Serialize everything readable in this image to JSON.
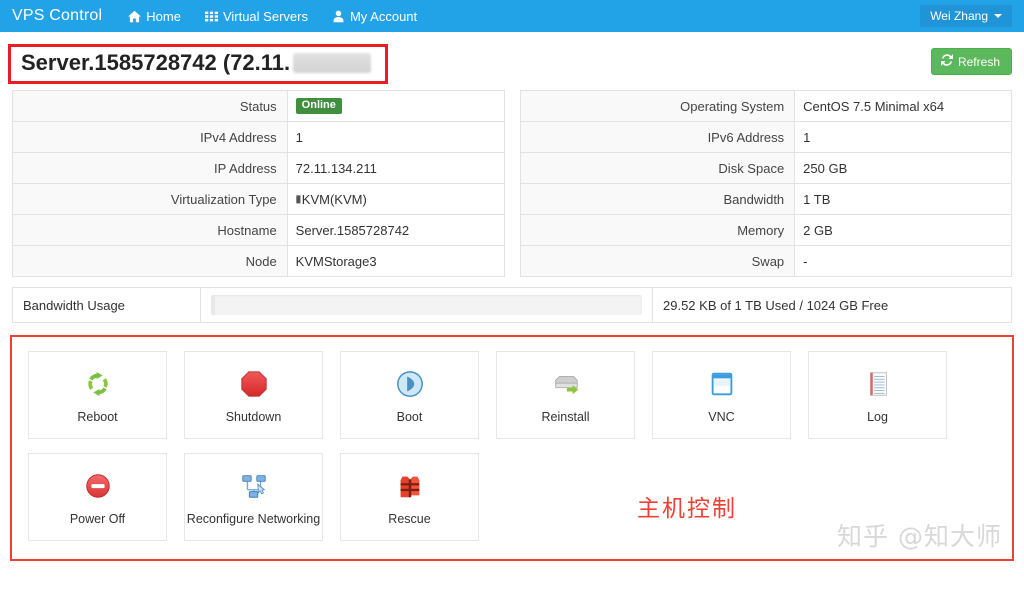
{
  "navbar": {
    "brand": "VPS Control",
    "items": [
      {
        "label": "Home",
        "icon": "home-icon"
      },
      {
        "label": "Virtual Servers",
        "icon": "grid-icon"
      },
      {
        "label": "My Account",
        "icon": "user-icon"
      }
    ],
    "user": "Wei Zhang",
    "accent_color": "#22a3e8"
  },
  "page": {
    "title_prefix": "Server.1585728742 (72.11.",
    "title_suffix": "",
    "title_redacted": true,
    "refresh_label": "Refresh",
    "refresh_icon": "refresh-icon",
    "annotation_border_color": "#ec1c24"
  },
  "left_table": {
    "rows": [
      {
        "label": "Status",
        "value": "Online",
        "type": "badge",
        "badge_color": "#3f8f3f"
      },
      {
        "label": "IPv4 Address",
        "value": "1",
        "type": "text"
      },
      {
        "label": "IP Address",
        "value": "72.11.134.211",
        "type": "text"
      },
      {
        "label": "Virtualization Type",
        "value": "KVM(KVM)",
        "type": "kvm"
      },
      {
        "label": "Hostname",
        "value": "Server.1585728742",
        "type": "text"
      },
      {
        "label": "Node",
        "value": "KVMStorage3",
        "type": "text"
      }
    ]
  },
  "right_table": {
    "rows": [
      {
        "label": "Operating System",
        "value": "CentOS 7.5 Minimal x64",
        "type": "text"
      },
      {
        "label": "IPv6 Address",
        "value": "1",
        "type": "text"
      },
      {
        "label": "Disk Space",
        "value": "250 GB",
        "type": "text"
      },
      {
        "label": "Bandwidth",
        "value": "1 TB",
        "type": "text"
      },
      {
        "label": "Memory",
        "value": "2 GB",
        "type": "text"
      },
      {
        "label": "Swap",
        "value": "-",
        "type": "text"
      }
    ]
  },
  "bandwidth": {
    "label": "Bandwidth Usage",
    "usage_text": "29.52 KB of 1 TB Used / 1024 GB Free",
    "percent": 1
  },
  "actions": {
    "border_color": "#ef4036",
    "annotation": "主机控制",
    "watermark": "知乎 @知大师",
    "items": [
      {
        "label": "Reboot",
        "icon": "reboot-icon"
      },
      {
        "label": "Shutdown",
        "icon": "stop-octagon-icon"
      },
      {
        "label": "Boot",
        "icon": "play-circle-icon"
      },
      {
        "label": "Reinstall",
        "icon": "server-arrow-icon"
      },
      {
        "label": "VNC",
        "icon": "window-icon"
      },
      {
        "label": "Log",
        "icon": "notepad-icon"
      },
      {
        "label": "Power Off",
        "icon": "power-off-icon"
      },
      {
        "label": "Reconfigure Networking",
        "icon": "network-icon"
      },
      {
        "label": "Rescue",
        "icon": "life-vest-icon"
      }
    ]
  }
}
